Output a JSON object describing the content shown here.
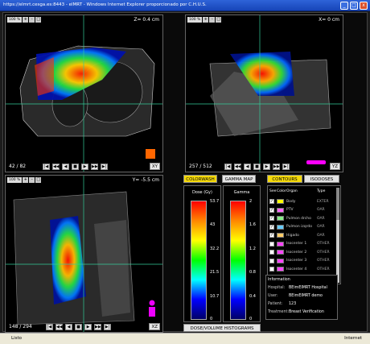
{
  "window": {
    "title": "https://elmrt.cesga.es:8443 - elMRT - Windows Internet Explorer proporcionado por C.H.U.S.",
    "minimize": "_",
    "maximize": "□",
    "close": "x"
  },
  "viewer": {
    "zoom_pct": "100 %",
    "zoom_buttons": {
      "plus": "+",
      "minus": "-",
      "fit": "□"
    },
    "playback": [
      "|◀",
      "◀◀",
      "◀",
      "■",
      "▶",
      "▶▶",
      "▶|"
    ],
    "axial": {
      "coord": "Z= 0.4 cm",
      "slice": "42 / 82",
      "view": "XY"
    },
    "sagittal": {
      "coord": "X= 0 cm",
      "slice": "257 / 512",
      "view": "YZ"
    },
    "coronal": {
      "coord": "Y= -5.5 cm",
      "slice": "148 / 294",
      "view": "XZ"
    }
  },
  "dose_panel": {
    "colorwash": "COLORWASH",
    "gamma_map": "GAMMA MAP",
    "dose_title": "Dose (Gy)",
    "gamma_title": "Gamma",
    "dose_ticks": [
      "53.7",
      "43",
      "32.2",
      "21.5",
      "10.7",
      "0"
    ],
    "gamma_ticks": [
      "2",
      "1.6",
      "1.2",
      "0.8",
      "0.4",
      "0"
    ],
    "histograms": "DOSE/VOLUME HISTOGRAMS"
  },
  "contours": {
    "tab_contours": "CONTOURS",
    "tab_isodoses": "ISODOSES",
    "headers": {
      "see": "See",
      "color": "Color",
      "organ": "Organ",
      "type": "Type"
    },
    "rows": [
      {
        "organ": "Body",
        "type": "EXTER",
        "color": "#ffff00",
        "checked": "✓"
      },
      {
        "organ": "PTV",
        "type": "OAR",
        "color": "#ff66ff",
        "checked": "✓"
      },
      {
        "organ": "Pulmon drcho",
        "type": "OAR",
        "color": "#88ee88",
        "checked": "✓"
      },
      {
        "organ": "Pulmon izqrdo",
        "type": "OAR",
        "color": "#66ccff",
        "checked": "✓"
      },
      {
        "organ": "Higado",
        "type": "OAR",
        "color": "#ffcc66",
        "checked": "✓"
      },
      {
        "organ": "Isocenter 1",
        "type": "OTHER",
        "color": "#ff44ff",
        "checked": ""
      },
      {
        "organ": "Isocenter 2",
        "type": "OTHER",
        "color": "#ff44ff",
        "checked": ""
      },
      {
        "organ": "Isocenter 3",
        "type": "OTHER",
        "color": "#ff44ff",
        "checked": ""
      },
      {
        "organ": "Isocenter 4",
        "type": "OTHER",
        "color": "#ff44ff",
        "checked": ""
      }
    ]
  },
  "information": {
    "title": "Information",
    "rows": [
      {
        "key": "Hospital:",
        "value": "BEimEIMRT Hospital"
      },
      {
        "key": "User:",
        "value": "BEimEIMRT demo"
      },
      {
        "key": "Patient:",
        "value": "123"
      },
      {
        "key": "Treatment:",
        "value": "Breast Verification"
      }
    ]
  },
  "status": {
    "left": "Listo",
    "right": "Internet"
  }
}
